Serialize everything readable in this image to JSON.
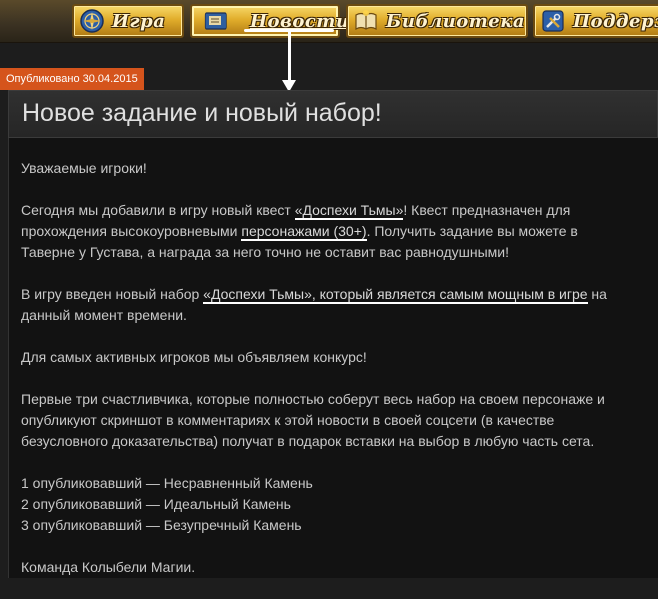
{
  "nav": {
    "items": [
      {
        "label": "Игра",
        "icon": "compass-icon"
      },
      {
        "label": "Новости",
        "icon": "newspaper-icon"
      },
      {
        "label": "Библиотека",
        "icon": "book-icon"
      },
      {
        "label": "Поддерж",
        "icon": "tools-icon"
      }
    ],
    "active": "Новости"
  },
  "article": {
    "date": "Опубликовано 30.04.2015",
    "title": "Новое задание и новый набор!",
    "greeting": "Уважаемые игроки!",
    "p1": {
      "t1": "Сегодня мы добавили в игру новый квест ",
      "link1": "«Доспехи Тьмы»",
      "t2": "! Квест предназначен для прохождения высокоуровневыми ",
      "link2": "персонажами (30+)",
      "t3": ". Получить задание вы можете в Таверне у Густава, а награда за него точно не оставит вас равнодушными!"
    },
    "p2": {
      "t1": "В игру введен новый набор ",
      "link1": "«Доспехи Тьмы», который является самым мощным в игре",
      "t2": " на данный момент времени."
    },
    "p3": "Для самых активных игроков мы объявляем конкурс!",
    "p4": "Первые три счастливчика, которые полностью соберут весь набор на своем персонаже и опубликуют скриншот в комментариях к этой новости в своей соцсети (в качестве безусловного доказательства) получат в подарок вставки на выбор в любую часть сета.",
    "prizes": [
      "1 опубликовавший — Несравненный Камень",
      "2 опубликовавший — Идеальный Камень",
      "3 опубликовавший — Безупречный Камень"
    ],
    "signature": "Команда Колыбели Магии."
  },
  "colors": {
    "page_bg": "#1d1d1d",
    "badge": "#d5541c",
    "nav_gold": "#e1ad2b",
    "text": "#c8c8c8"
  }
}
